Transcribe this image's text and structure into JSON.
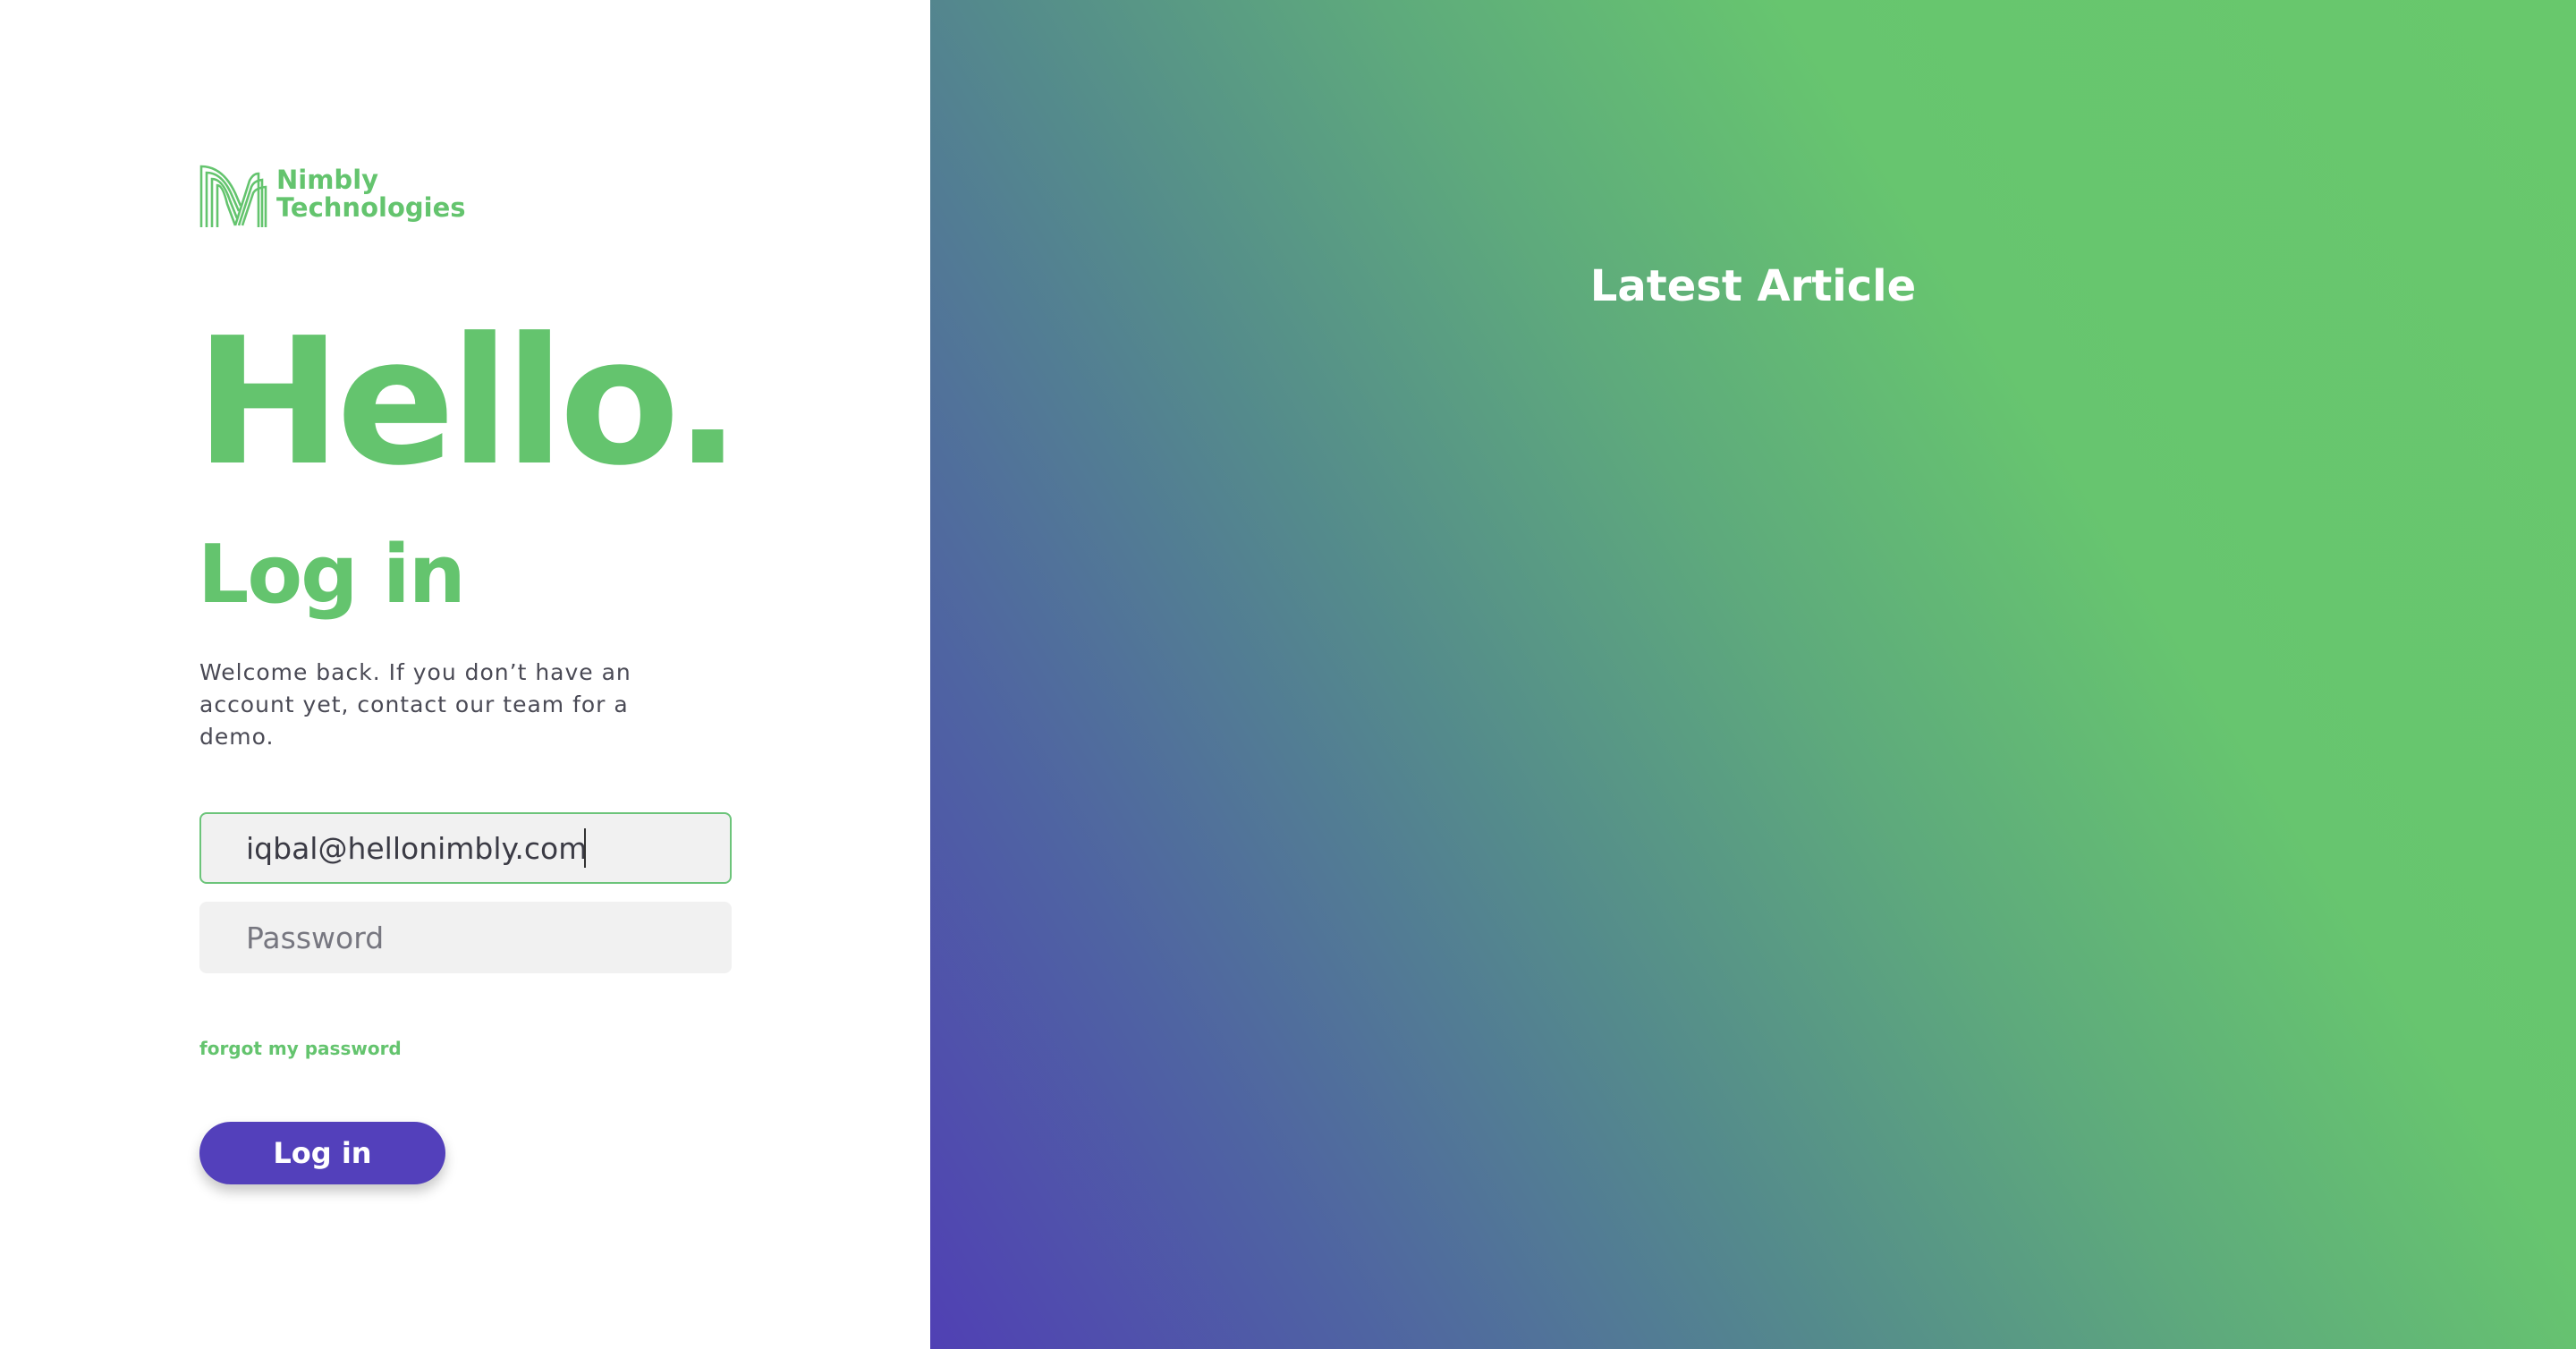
{
  "brand": {
    "name_line1": "Nimbly",
    "name_line2": "Technologies",
    "color": "#64c46e",
    "icon": "nimbly-logo-icon"
  },
  "hero": {
    "greeting": "Hello.",
    "title": "Log in",
    "description": "Welcome back. If you don’t have an account yet, contact our team for a demo."
  },
  "form": {
    "email_value": "iqbal@hellonimbly.com",
    "password_placeholder": "Password",
    "forgot_label": "forgot my password",
    "submit_label": "Log in",
    "submit_color": "#5340bb"
  },
  "panel": {
    "title": "Latest Article",
    "gradient_colors": [
      "#5040b4",
      "#68c86c"
    ]
  }
}
